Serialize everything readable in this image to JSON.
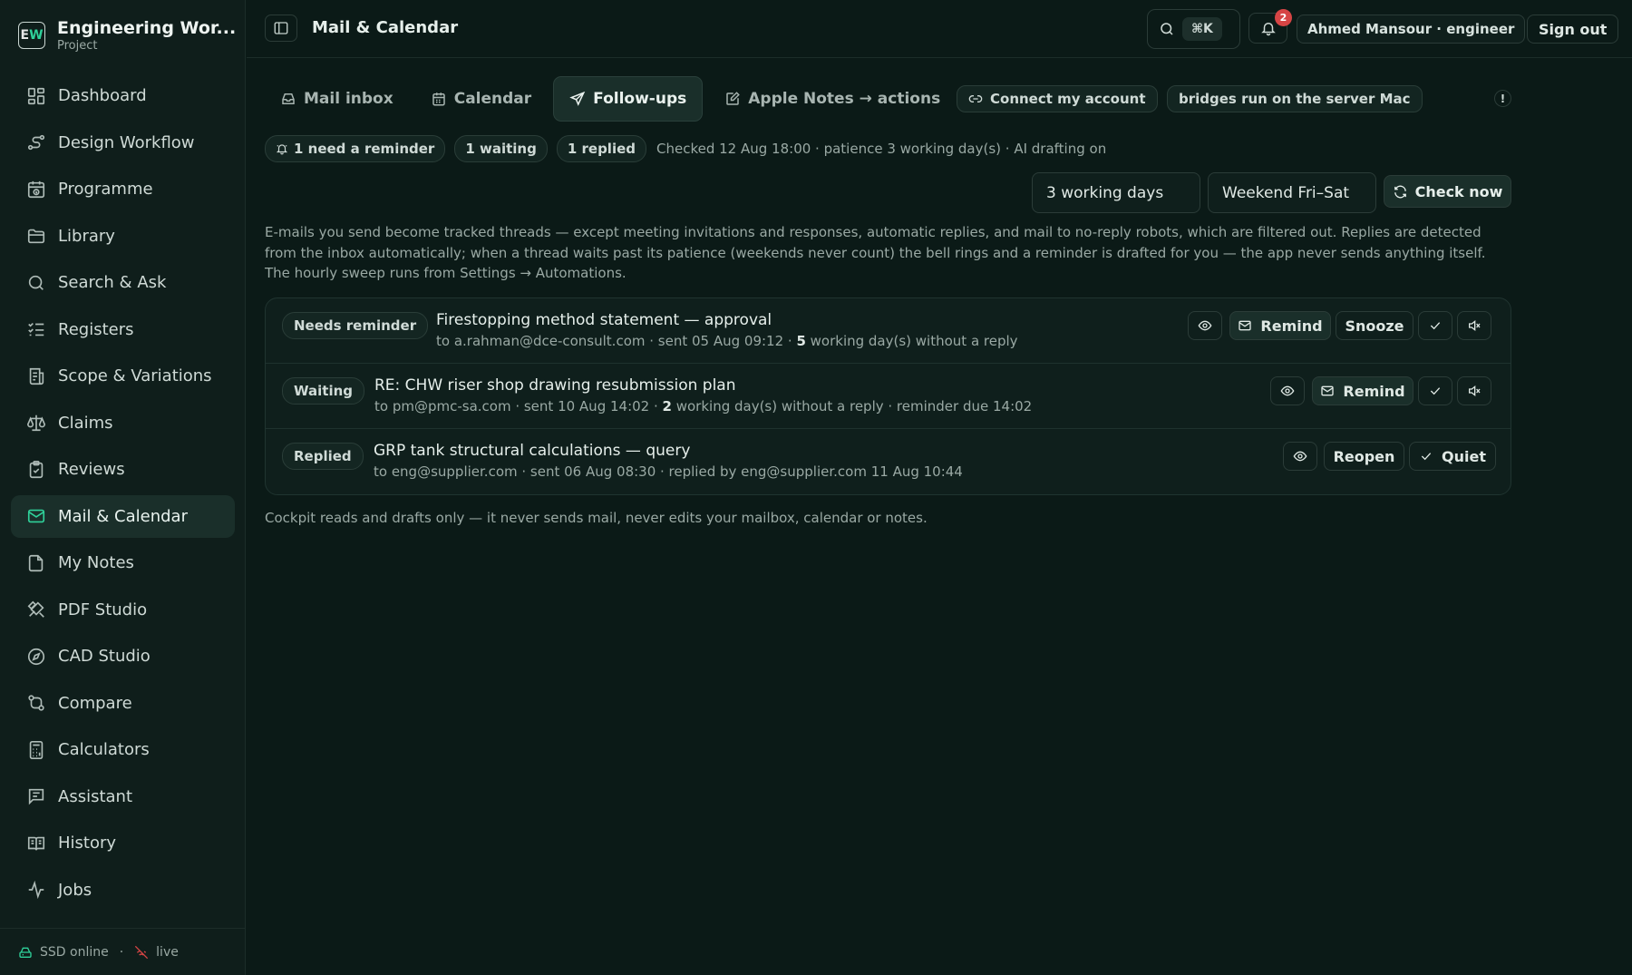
{
  "brand": {
    "logo_left": "E",
    "logo_right": "W",
    "title": "Engineering Wor...",
    "subtitle": "Project"
  },
  "sidebar": {
    "items": [
      {
        "label": "Dashboard",
        "icon": "dashboard-icon"
      },
      {
        "label": "Design Workflow",
        "icon": "workflow-icon"
      },
      {
        "label": "Programme",
        "icon": "calendar-clock-icon"
      },
      {
        "label": "Library",
        "icon": "folder-icon"
      },
      {
        "label": "Search & Ask",
        "icon": "search-icon"
      },
      {
        "label": "Registers",
        "icon": "list-check-icon"
      },
      {
        "label": "Scope & Variations",
        "icon": "receipt-icon"
      },
      {
        "label": "Claims",
        "icon": "scale-icon"
      },
      {
        "label": "Reviews",
        "icon": "clipboard-icon"
      },
      {
        "label": "Mail & Calendar",
        "icon": "mail-icon",
        "active": true
      },
      {
        "label": "My Notes",
        "icon": "note-icon"
      },
      {
        "label": "PDF Studio",
        "icon": "tools-icon"
      },
      {
        "label": "CAD Studio",
        "icon": "compass-icon"
      },
      {
        "label": "Compare",
        "icon": "compare-icon"
      },
      {
        "label": "Calculators",
        "icon": "calculator-icon"
      },
      {
        "label": "Assistant",
        "icon": "chat-icon"
      },
      {
        "label": "History",
        "icon": "book-icon"
      },
      {
        "label": "Jobs",
        "icon": "activity-icon"
      }
    ],
    "footer": {
      "storage": "SSD online",
      "separator": "·",
      "live": "live"
    }
  },
  "topbar": {
    "title": "Mail & Calendar",
    "shortcut": "⌘K",
    "notification_count": "2",
    "user": "Ahmed Mansour · engineer",
    "sign_out": "Sign out"
  },
  "tabs": [
    {
      "label": "Mail inbox",
      "icon": "inbox-icon"
    },
    {
      "label": "Calendar",
      "icon": "calendar-icon"
    },
    {
      "label": "Follow-ups",
      "icon": "send-icon",
      "active": true
    },
    {
      "label": "Apple Notes → actions",
      "icon": "edit-note-icon"
    }
  ],
  "chips": {
    "connect": "Connect my account",
    "bridges": "bridges run on the server Mac",
    "alert": "!"
  },
  "stats": {
    "need_reminder": "1 need a reminder",
    "waiting": "1 waiting",
    "replied": "1 replied",
    "checked": "Checked 12 Aug 18:00 · patience 3 working day(s) · AI drafting on"
  },
  "controls": {
    "patience": "3 working days",
    "weekend": "Weekend Fri–Sat",
    "check_now": "Check now"
  },
  "description": "E-mails you send become tracked threads — except meeting invitations and responses, automatic replies, and mail to no-reply robots, which are filtered out. Replies are detected from the inbox automatically; when a thread waits past its patience (weekends never count) the bell rings and a reminder is drafted for you — the app never sends anything itself. The hourly sweep runs from Settings → Automations.",
  "threads": [
    {
      "status": "Needs reminder",
      "subject": "Firestopping method statement — approval",
      "meta_before": "to a.rahman@dce-consult.com · sent 05 Aug 09:12 · ",
      "meta_count": "5",
      "meta_after": " working day(s) without a reply",
      "actions": {
        "remind": "Remind",
        "snooze": "Snooze"
      }
    },
    {
      "status": "Waiting",
      "subject": "RE: CHW riser shop drawing resubmission plan",
      "meta_before": "to pm@pmc-sa.com · sent 10 Aug 14:02 · ",
      "meta_count": "2",
      "meta_after": " working day(s) without a reply · reminder due 14:02",
      "actions": {
        "remind": "Remind"
      }
    },
    {
      "status": "Replied",
      "subject": "GRP tank structural calculations — query",
      "meta": "to eng@supplier.com · sent 06 Aug 08:30 · replied by eng@supplier.com 11 Aug 10:44",
      "actions": {
        "reopen": "Reopen",
        "quiet": "Quiet"
      }
    }
  ],
  "footnote": "Cockpit reads and drafts only — it never sends mail, never edits your mailbox, calendar or notes.",
  "colors": {
    "accent": "#2fd19a",
    "background": "#0b1a17",
    "badge": "#d64545"
  }
}
